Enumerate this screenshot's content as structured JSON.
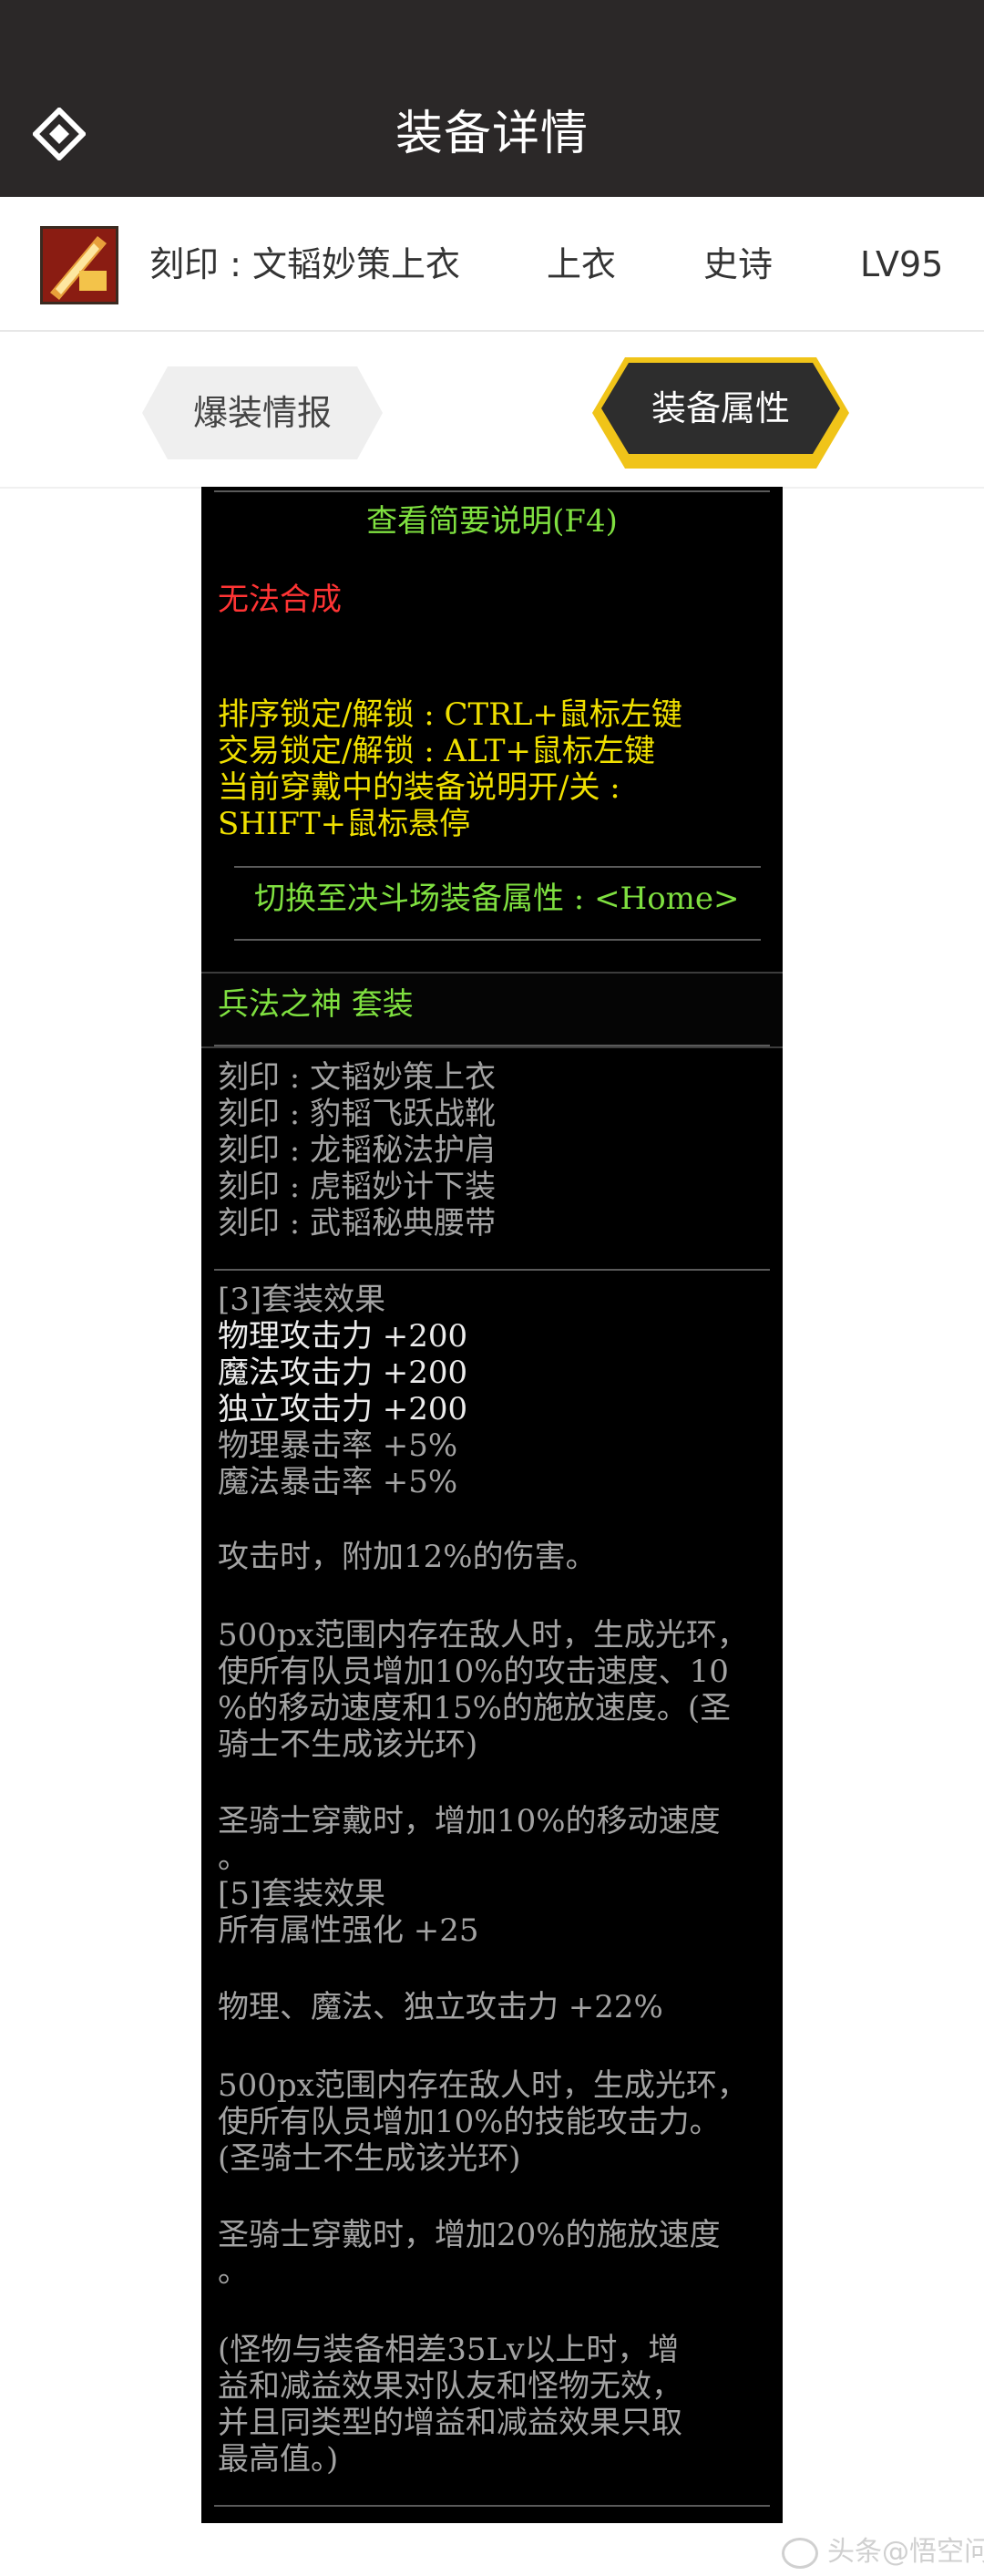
{
  "header": {
    "title": "装备详情",
    "back_icon": "diamond-back-icon"
  },
  "item": {
    "name": "刻印 : 文韬妙策上衣",
    "slot": "上衣",
    "rarity": "史诗",
    "level": "LV95",
    "icon": "item-thumbnail-icon"
  },
  "tabs": [
    {
      "label": "爆装情报",
      "active": false
    },
    {
      "label": "装备属性",
      "active": true
    }
  ],
  "tooltip": {
    "summary_link": "查看简要说明(F4)",
    "cannot_combine": "无法合成",
    "lock_lines": [
      "排序锁定/解锁 : CTRL+鼠标左键",
      "交易锁定/解锁 : ALT+鼠标左键",
      "当前穿戴中的装备说明开/关 :",
      "SHIFT+鼠标悬停"
    ],
    "switch_line": "切换至决斗场装备属性 : <Home>",
    "set_name": "兵法之神 套装",
    "set_items": [
      "刻印 : 文韬妙策上衣",
      "刻印 : 豹韬飞跃战靴",
      "刻印 : 龙韬秘法护肩",
      "刻印 : 虎韬妙计下装",
      "刻印 : 武韬秘典腰带"
    ],
    "effect3_title": "[3]套装效果",
    "effect3_stats": [
      "物理攻击力 +200",
      "魔法攻击力 +200",
      "独立攻击力 +200"
    ],
    "effect3_crit": [
      "物理暴击率 +5%",
      "魔法暴击率 +5%"
    ],
    "effect3_attack": "攻击时，附加12%的伤害。",
    "effect3_aura": [
      "500px范围内存在敌人时，生成光环，",
      "使所有队员增加10%的攻击速度、10",
      "%的移动速度和15%的施放速度。(圣",
      "骑士不生成该光环)"
    ],
    "effect3_paladin": [
      "圣骑士穿戴时，增加10%的移动速度",
      "。"
    ],
    "effect5_title": "[5]套装效果",
    "effect5_allstat": "所有属性强化 +25",
    "effect5_atk": "物理、魔法、独立攻击力 +22%",
    "effect5_aura": [
      "500px范围内存在敌人时，生成光环，",
      "使所有队员增加10%的技能攻击力。",
      "(圣骑士不生成该光环)"
    ],
    "effect5_paladin": [
      "圣骑士穿戴时，增加20%的施放速度",
      "。"
    ],
    "note": [
      "(怪物与装备相差35Lv以上时，增",
      "益和减益效果对队友和怪物无效，",
      "并且同类型的增益和减益效果只取",
      "最高值。)"
    ]
  },
  "watermark": "头条@悟空问答",
  "colors": {
    "topbar": "#2b2828",
    "accent_gold": "#f0c419",
    "tooltip_green": "#7fe040",
    "tooltip_red": "#ff3434",
    "tooltip_yellow": "#f0e000",
    "tooltip_gray": "#a3a3a3"
  }
}
